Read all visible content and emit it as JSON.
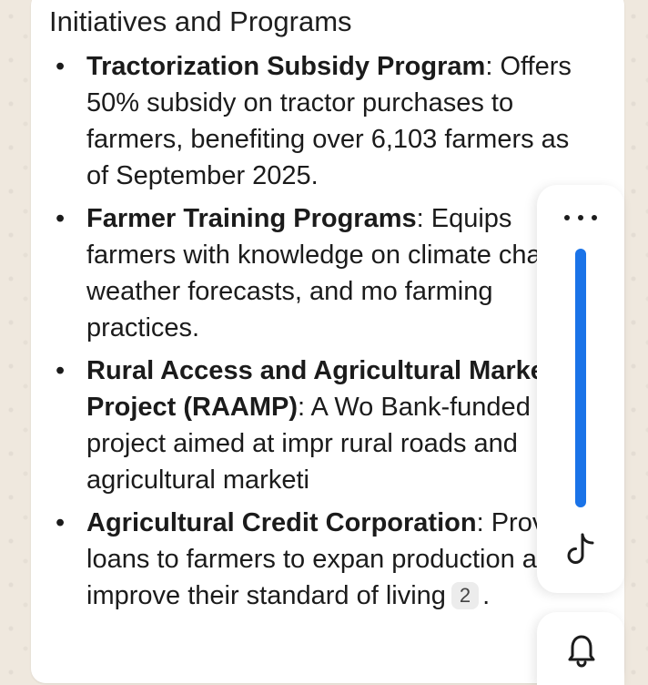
{
  "section": {
    "title": "Initiatives and Programs"
  },
  "items": [
    {
      "title": "Tractorization Subsidy Program",
      "text": ": Offers 50% subsidy on tractor purchases to farmers, benefiting over 6,103 farmers as of September 2025."
    },
    {
      "title": "Farmer Training Programs",
      "text": ": Equips farmers with knowledge on climate change, weather forecasts, and mo farming practices."
    },
    {
      "title": "Rural Access and Agricultural Marketing Project (RAAMP)",
      "text": ": A Wo Bank-funded project aimed at impr rural roads and agricultural marketi"
    },
    {
      "title": "Agricultural Credit Corporation",
      "text": ": Provides loans to farmers to expan production and improve their standard of living",
      "citation": "2",
      "trailing": "."
    }
  ],
  "toolbar": {
    "icons": [
      "more-icon",
      "scroll-thumb",
      "tiktok-icon",
      "bell-icon"
    ],
    "accent_color": "#1a73e8"
  }
}
